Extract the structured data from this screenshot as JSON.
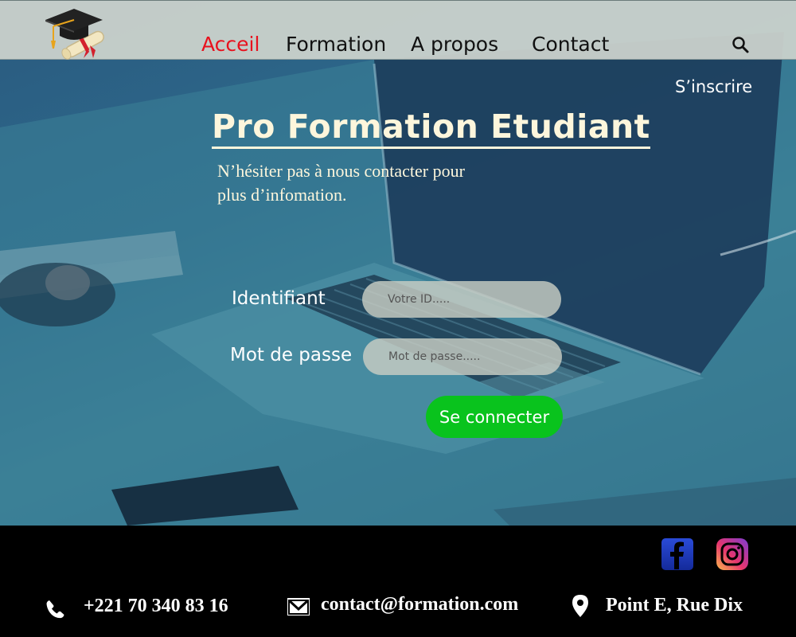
{
  "nav": {
    "items": [
      {
        "label": "Acceil",
        "active": true
      },
      {
        "label": "Formation",
        "active": false
      },
      {
        "label": "A propos",
        "active": false
      },
      {
        "label": "Contact",
        "active": false
      }
    ],
    "search_icon": "search-icon",
    "logo_icon": "graduation-cap-icon"
  },
  "hero": {
    "signup_label": "S’inscrire",
    "title": "Pro Formation Etudiant",
    "text_line1": "N’hésiter pas à nous contacter pour",
    "text_line2": "plus d’infomation."
  },
  "login": {
    "id_label": "Identifiant",
    "id_placeholder": "Votre ID.....",
    "password_label": "Mot de passe",
    "password_placeholder": "Mot de passe.....",
    "submit_label": "Se connecter"
  },
  "footer": {
    "social": [
      {
        "name": "facebook-icon"
      },
      {
        "name": "instagram-icon"
      }
    ],
    "phone": "+221 70 340 83 16",
    "email": "contact@formation.com",
    "address": "Point E, Rue Dix"
  },
  "colors": {
    "nav_active": "#e8121e",
    "accent_button": "#09c31d",
    "title_text": "#fdf6dc",
    "header_bg": "#cdd4cd"
  }
}
